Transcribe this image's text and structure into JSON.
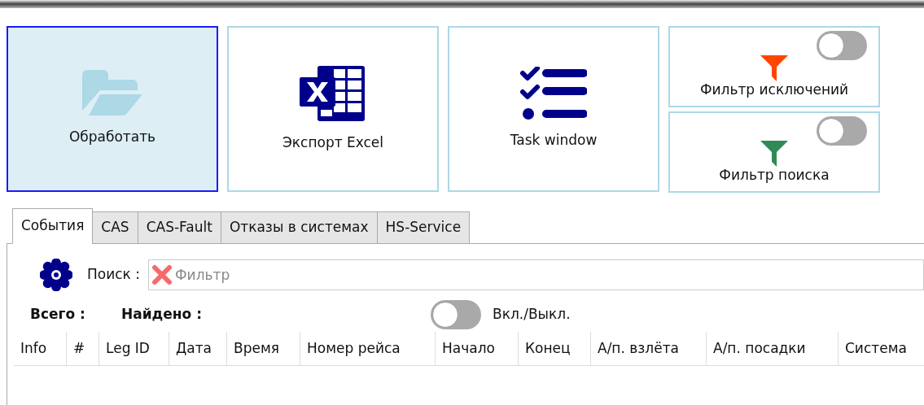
{
  "actions": [
    {
      "kind": "folder",
      "label": "Обработать",
      "selected": true
    },
    {
      "kind": "excel",
      "label": "Экспорт Excel",
      "selected": false
    },
    {
      "kind": "tasks",
      "label": "Task window",
      "selected": false
    }
  ],
  "filters": [
    {
      "label": "Фильтр исключений",
      "color": "#ff4500",
      "on": false
    },
    {
      "label": "Фильтр поиска",
      "color": "#2e8b57",
      "on": false
    }
  ],
  "tabs": [
    {
      "label": "События",
      "selected": true
    },
    {
      "label": "CAS",
      "selected": false
    },
    {
      "label": "CAS-Fault",
      "selected": false
    },
    {
      "label": "Отказы в системах",
      "selected": false
    },
    {
      "label": "HS-Service",
      "selected": false
    }
  ],
  "search": {
    "label": "Поиск :",
    "placeholder": "Фильтр"
  },
  "totals": [
    {
      "label": "Всего :"
    },
    {
      "label": "Найдено :"
    }
  ],
  "toggle": {
    "label": "Вкл./Выкл.",
    "on": false
  },
  "table": {
    "columns": [
      "Info",
      "#",
      "Leg ID",
      "Дата",
      "Время",
      "Номер рейса",
      "Начало",
      "Конец",
      "А/п. взлёта",
      "А/п. посадки",
      "Система"
    ]
  }
}
